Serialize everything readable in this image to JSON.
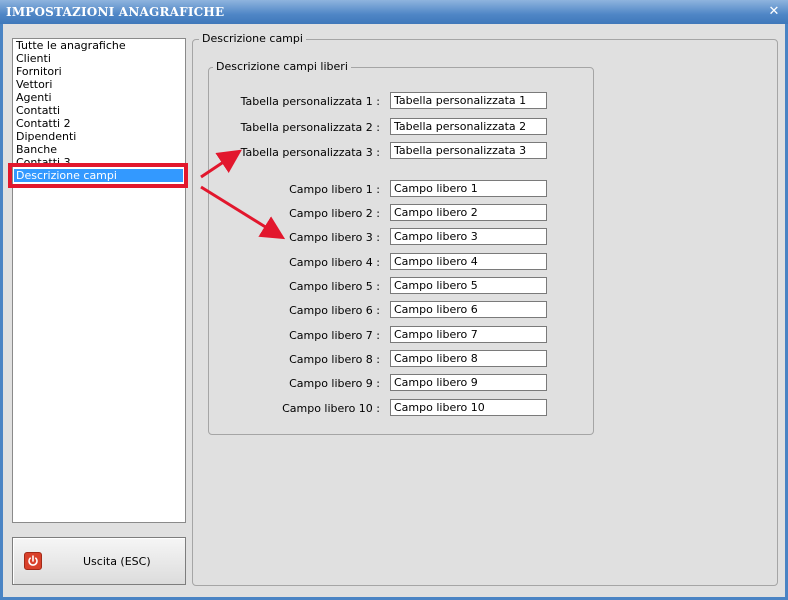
{
  "window": {
    "title": "IMPOSTAZIONI ANAGRAFICHE",
    "close_glyph": "✕"
  },
  "sidebar": {
    "items": [
      {
        "label": "Tutte le anagrafiche"
      },
      {
        "label": "Clienti"
      },
      {
        "label": "Fornitori"
      },
      {
        "label": "Vettori"
      },
      {
        "label": "Agenti"
      },
      {
        "label": "Contatti"
      },
      {
        "label": "Contatti 2"
      },
      {
        "label": "Dipendenti"
      },
      {
        "label": "Banche"
      },
      {
        "label": "Contatti 3"
      },
      {
        "label": "Descrizione campi",
        "selected": true
      }
    ]
  },
  "exit_button": {
    "label": "Uscita (ESC)",
    "icon": "power-icon"
  },
  "panel": {
    "title": "Descrizione campi",
    "inner_title": "Descrizione campi liberi",
    "tables": [
      {
        "label": "Tabella personalizzata 1 :",
        "value": "Tabella personalizzata 1"
      },
      {
        "label": "Tabella personalizzata 2 :",
        "value": "Tabella personalizzata 2"
      },
      {
        "label": "Tabella personalizzata 3 :",
        "value": "Tabella personalizzata 3"
      }
    ],
    "fields": [
      {
        "label": "Campo libero 1 :",
        "value": "Campo libero 1"
      },
      {
        "label": "Campo libero 2 :",
        "value": "Campo libero 2"
      },
      {
        "label": "Campo libero 3 :",
        "value": "Campo libero 3"
      },
      {
        "label": "Campo libero 4 :",
        "value": "Campo libero 4"
      },
      {
        "label": "Campo libero 5 :",
        "value": "Campo libero 5"
      },
      {
        "label": "Campo libero 6 :",
        "value": "Campo libero 6"
      },
      {
        "label": "Campo libero 7 :",
        "value": "Campo libero 7"
      },
      {
        "label": "Campo libero 8 :",
        "value": "Campo libero 8"
      },
      {
        "label": "Campo libero 9 :",
        "value": "Campo libero 9"
      },
      {
        "label": "Campo libero 10 :",
        "value": "Campo libero 10"
      }
    ]
  },
  "annotation_color": "#e2172d"
}
